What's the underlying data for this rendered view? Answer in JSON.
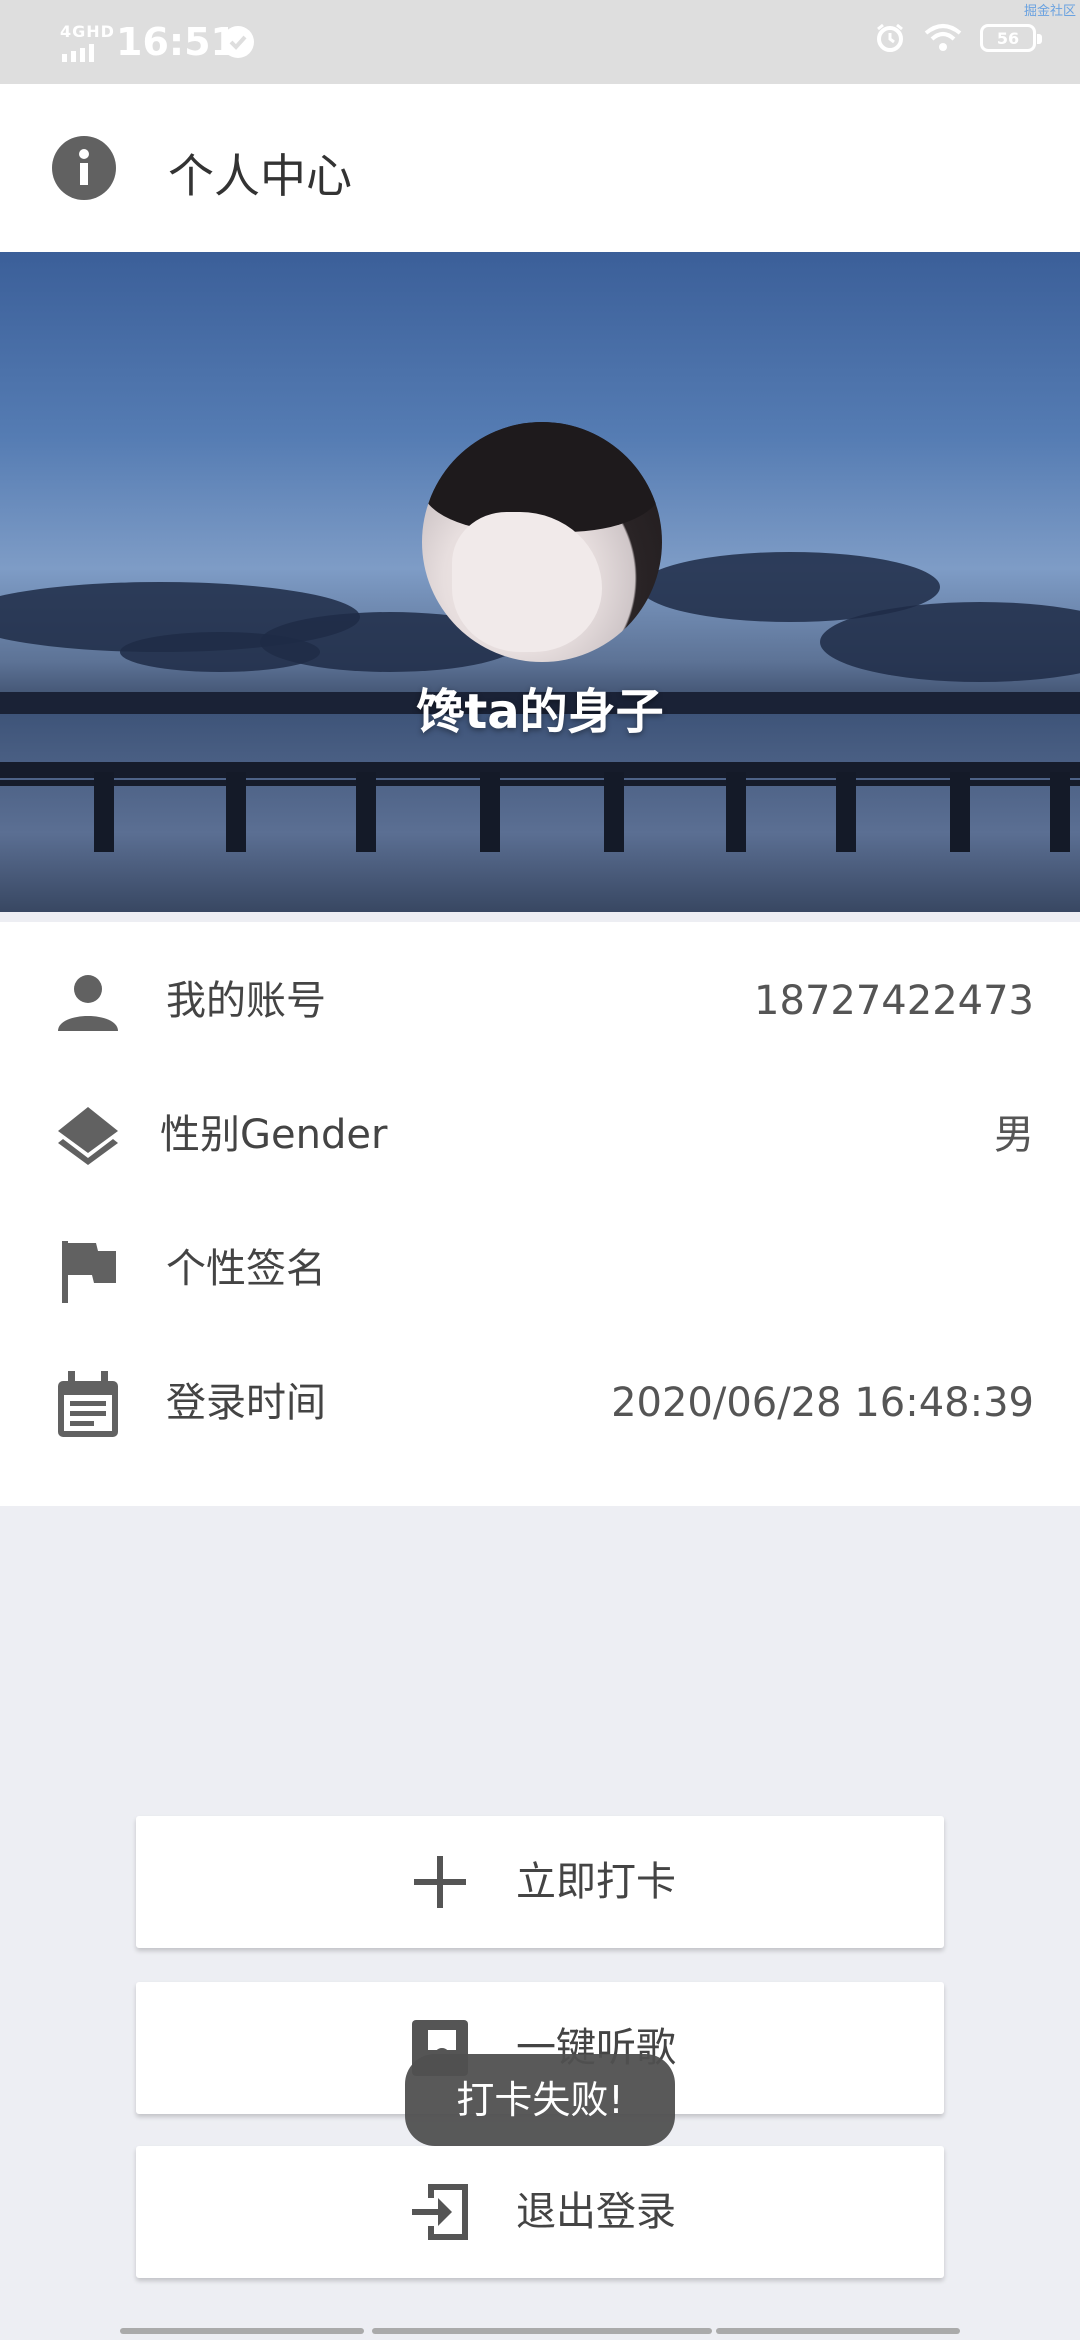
{
  "status_bar": {
    "network": "4GHD",
    "time": "16:51",
    "battery": "56",
    "corner_text": "掘金社区"
  },
  "header": {
    "title": "个人中心",
    "icon": "info-icon"
  },
  "profile": {
    "username": "馋ta的身子"
  },
  "info_rows": [
    {
      "icon": "person-icon",
      "label": "我的账号",
      "value": "18727422473"
    },
    {
      "icon": "layers-icon",
      "label": "性别Gender",
      "value": "男"
    },
    {
      "icon": "flag-icon",
      "label": "个性签名",
      "value": ""
    },
    {
      "icon": "calendar-icon",
      "label": "登录时间",
      "value": "2020/06/28 16:48:39"
    }
  ],
  "actions": [
    {
      "icon": "plus-icon",
      "label": "立即打卡"
    },
    {
      "icon": "music-icon",
      "label": "一键听歌"
    },
    {
      "icon": "exit-icon",
      "label": "退出登录"
    }
  ],
  "toast": "打卡失败!",
  "colors": {
    "icon_gray": "#616161",
    "background": "#edeef3",
    "toast_bg": "#505050"
  }
}
